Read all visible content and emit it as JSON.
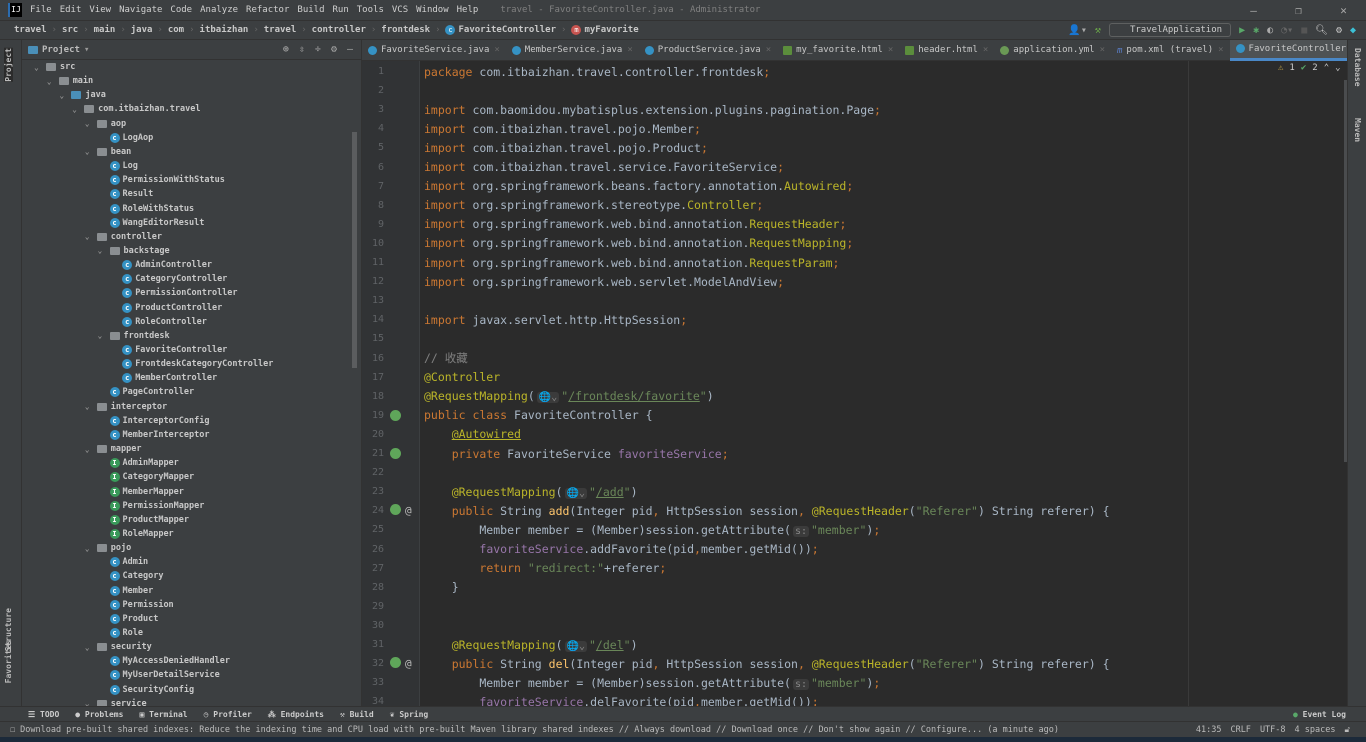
{
  "menu": {
    "items": [
      "File",
      "Edit",
      "View",
      "Navigate",
      "Code",
      "Analyze",
      "Refactor",
      "Build",
      "Run",
      "Tools",
      "VCS",
      "Window",
      "Help"
    ],
    "window_title": "travel - FavoriteController.java - Administrator"
  },
  "breadcrumb": [
    "travel",
    "src",
    "main",
    "java",
    "com",
    "itbaizhan",
    "travel",
    "controller",
    "frontdesk",
    "FavoriteController",
    "myFavorite"
  ],
  "toolbar": {
    "run_config": "TravelApplication"
  },
  "left_stripe": {
    "project": "Project",
    "structure": "Structure",
    "favorites": "Favorites"
  },
  "right_stripe": {
    "database": "Database",
    "maven": "Maven"
  },
  "project": {
    "title": "Project",
    "tree": [
      [
        "src",
        1,
        "folder"
      ],
      [
        "main",
        2,
        "folder"
      ],
      [
        "java",
        3,
        "folder-blue"
      ],
      [
        "com.itbaizhan.travel",
        4,
        "package"
      ],
      [
        "aop",
        5,
        "package"
      ],
      [
        "LogAop",
        6,
        "class"
      ],
      [
        "bean",
        5,
        "package"
      ],
      [
        "Log",
        6,
        "class"
      ],
      [
        "PermissionWithStatus",
        6,
        "class"
      ],
      [
        "Result",
        6,
        "class"
      ],
      [
        "RoleWithStatus",
        6,
        "class"
      ],
      [
        "WangEditorResult",
        6,
        "class"
      ],
      [
        "controller",
        5,
        "package"
      ],
      [
        "backstage",
        6,
        "package"
      ],
      [
        "AdminController",
        7,
        "class"
      ],
      [
        "CategoryController",
        7,
        "class"
      ],
      [
        "PermissionController",
        7,
        "class"
      ],
      [
        "ProductController",
        7,
        "class"
      ],
      [
        "RoleController",
        7,
        "class"
      ],
      [
        "frontdesk",
        6,
        "package"
      ],
      [
        "FavoriteController",
        7,
        "class"
      ],
      [
        "FrontdeskCategoryController",
        7,
        "class"
      ],
      [
        "MemberController",
        7,
        "class"
      ],
      [
        "PageController",
        6,
        "class"
      ],
      [
        "interceptor",
        5,
        "package"
      ],
      [
        "InterceptorConfig",
        6,
        "class"
      ],
      [
        "MemberInterceptor",
        6,
        "class"
      ],
      [
        "mapper",
        5,
        "package"
      ],
      [
        "AdminMapper",
        6,
        "mapper"
      ],
      [
        "CategoryMapper",
        6,
        "mapper"
      ],
      [
        "MemberMapper",
        6,
        "mapper"
      ],
      [
        "PermissionMapper",
        6,
        "mapper"
      ],
      [
        "ProductMapper",
        6,
        "mapper"
      ],
      [
        "RoleMapper",
        6,
        "mapper"
      ],
      [
        "pojo",
        5,
        "package"
      ],
      [
        "Admin",
        6,
        "class"
      ],
      [
        "Category",
        6,
        "class"
      ],
      [
        "Member",
        6,
        "class"
      ],
      [
        "Permission",
        6,
        "class"
      ],
      [
        "Product",
        6,
        "class"
      ],
      [
        "Role",
        6,
        "class"
      ],
      [
        "security",
        5,
        "package"
      ],
      [
        "MyAccessDeniedHandler",
        6,
        "class"
      ],
      [
        "MyUserDetailService",
        6,
        "class"
      ],
      [
        "SecurityConfig",
        6,
        "class"
      ],
      [
        "service",
        5,
        "package"
      ]
    ]
  },
  "tabs": [
    {
      "label": "FavoriteService.java",
      "icon": "class"
    },
    {
      "label": "MemberService.java",
      "icon": "class"
    },
    {
      "label": "ProductService.java",
      "icon": "class"
    },
    {
      "label": "my_favorite.html",
      "icon": "html"
    },
    {
      "label": "header.html",
      "icon": "html"
    },
    {
      "label": "application.yml",
      "icon": "yml"
    },
    {
      "label": "pom.xml (travel)",
      "icon": "m"
    },
    {
      "label": "FavoriteController.java",
      "icon": "class",
      "active": true
    }
  ],
  "inspections": {
    "warnings": "1",
    "weak_warnings": "2"
  },
  "code": [
    [
      [
        "k",
        "package "
      ],
      [
        "t",
        "com.itbaizhan.travel.controller.frontdesk"
      ],
      [
        "k",
        ";"
      ]
    ],
    [],
    [
      [
        "k",
        "import "
      ],
      [
        "t",
        "com.baomidou.mybatisplus.extension.plugins.pagination.Page"
      ],
      [
        "k",
        ";"
      ]
    ],
    [
      [
        "k",
        "import "
      ],
      [
        "t",
        "com.itbaizhan.travel.pojo.Member"
      ],
      [
        "k",
        ";"
      ]
    ],
    [
      [
        "k",
        "import "
      ],
      [
        "t",
        "com.itbaizhan.travel.pojo.Product"
      ],
      [
        "k",
        ";"
      ]
    ],
    [
      [
        "k",
        "import "
      ],
      [
        "t",
        "com.itbaizhan.travel.service.FavoriteService"
      ],
      [
        "k",
        ";"
      ]
    ],
    [
      [
        "k",
        "import "
      ],
      [
        "t",
        "org.springframework.beans.factory.annotation."
      ],
      [
        "a",
        "Autowired"
      ],
      [
        "k",
        ";"
      ]
    ],
    [
      [
        "k",
        "import "
      ],
      [
        "t",
        "org.springframework.stereotype."
      ],
      [
        "a",
        "Controller"
      ],
      [
        "k",
        ";"
      ]
    ],
    [
      [
        "k",
        "import "
      ],
      [
        "t",
        "org.springframework.web.bind.annotation."
      ],
      [
        "a",
        "RequestHeader"
      ],
      [
        "k",
        ";"
      ]
    ],
    [
      [
        "k",
        "import "
      ],
      [
        "t",
        "org.springframework.web.bind.annotation."
      ],
      [
        "a",
        "RequestMapping"
      ],
      [
        "k",
        ";"
      ]
    ],
    [
      [
        "k",
        "import "
      ],
      [
        "t",
        "org.springframework.web.bind.annotation."
      ],
      [
        "a",
        "RequestParam"
      ],
      [
        "k",
        ";"
      ]
    ],
    [
      [
        "k",
        "import "
      ],
      [
        "t",
        "org.springframework.web.servlet.ModelAndView"
      ],
      [
        "k",
        ";"
      ]
    ],
    [],
    [
      [
        "k",
        "import "
      ],
      [
        "t",
        "javax.servlet.http.HttpSession"
      ],
      [
        "k",
        ";"
      ]
    ],
    [],
    [
      [
        "c",
        "// 收藏"
      ]
    ],
    [
      [
        "a",
        "@Controller"
      ]
    ],
    [
      [
        "a",
        "@RequestMapping"
      ],
      [
        "t",
        "("
      ],
      [
        "h",
        "🌐⌄"
      ],
      [
        "s",
        "\""
      ],
      [
        "su",
        "/frontdesk/favorite"
      ],
      [
        "s",
        "\""
      ],
      [
        "t",
        ")"
      ]
    ],
    [
      [
        "k",
        "public class "
      ],
      [
        "t",
        "FavoriteController {"
      ]
    ],
    [
      [
        "t",
        "    "
      ],
      [
        "au",
        "@Autowired"
      ]
    ],
    [
      [
        "t",
        "    "
      ],
      [
        "k",
        "private "
      ],
      [
        "t",
        "FavoriteService "
      ],
      [
        "f",
        "favoriteService"
      ],
      [
        "k",
        ";"
      ]
    ],
    [],
    [
      [
        "t",
        "    "
      ],
      [
        "a",
        "@RequestMapping"
      ],
      [
        "t",
        "("
      ],
      [
        "h",
        "🌐⌄"
      ],
      [
        "s",
        "\""
      ],
      [
        "su",
        "/add"
      ],
      [
        "s",
        "\""
      ],
      [
        "t",
        ")"
      ]
    ],
    [
      [
        "t",
        "    "
      ],
      [
        "k",
        "public "
      ],
      [
        "t",
        "String "
      ],
      [
        "m",
        "add"
      ],
      [
        "t",
        "(Integer pid"
      ],
      [
        "k",
        ", "
      ],
      [
        "t",
        "HttpSession session"
      ],
      [
        "k",
        ", "
      ],
      [
        "a",
        "@RequestHeader"
      ],
      [
        "t",
        "("
      ],
      [
        "s",
        "\"Referer\""
      ],
      [
        "t",
        ") String referer) {"
      ]
    ],
    [
      [
        "t",
        "        Member member = (Member)session.getAttribute("
      ],
      [
        "h",
        "s:"
      ],
      [
        "s",
        "\"member\""
      ],
      [
        "t",
        ")"
      ],
      [
        "k",
        ";"
      ]
    ],
    [
      [
        "t",
        "        "
      ],
      [
        "f",
        "favoriteService"
      ],
      [
        "t",
        ".addFavorite(pid"
      ],
      [
        "k",
        ","
      ],
      [
        "t",
        "member.getMid())"
      ],
      [
        "k",
        ";"
      ]
    ],
    [
      [
        "t",
        "        "
      ],
      [
        "k",
        "return "
      ],
      [
        "s",
        "\"redirect:\""
      ],
      [
        "t",
        "+referer"
      ],
      [
        "k",
        ";"
      ]
    ],
    [
      [
        "t",
        "    }"
      ]
    ],
    [],
    [],
    [
      [
        "t",
        "    "
      ],
      [
        "a",
        "@RequestMapping"
      ],
      [
        "t",
        "("
      ],
      [
        "h",
        "🌐⌄"
      ],
      [
        "s",
        "\""
      ],
      [
        "su",
        "/del"
      ],
      [
        "s",
        "\""
      ],
      [
        "t",
        ")"
      ]
    ],
    [
      [
        "t",
        "    "
      ],
      [
        "k",
        "public "
      ],
      [
        "t",
        "String "
      ],
      [
        "m",
        "del"
      ],
      [
        "t",
        "(Integer pid"
      ],
      [
        "k",
        ", "
      ],
      [
        "t",
        "HttpSession session"
      ],
      [
        "k",
        ", "
      ],
      [
        "a",
        "@RequestHeader"
      ],
      [
        "t",
        "("
      ],
      [
        "s",
        "\"Referer\""
      ],
      [
        "t",
        ") String referer) {"
      ]
    ],
    [
      [
        "t",
        "        Member member = (Member)session.getAttribute("
      ],
      [
        "h",
        "s:"
      ],
      [
        "s",
        "\"member\""
      ],
      [
        "t",
        ")"
      ],
      [
        "k",
        ";"
      ]
    ],
    [
      [
        "t",
        "        "
      ],
      [
        "f",
        "favoriteService"
      ],
      [
        "t",
        ".delFavorite(pid"
      ],
      [
        "k",
        ","
      ],
      [
        "t",
        "member.getMid())"
      ],
      [
        "k",
        ";"
      ]
    ]
  ],
  "gutter_beans": [
    19,
    21,
    24,
    32
  ],
  "gutter_at": [
    24,
    32
  ],
  "bottom_tools": [
    "TODO",
    "Problems",
    "Terminal",
    "Profiler",
    "Endpoints",
    "Build",
    "Spring"
  ],
  "event_log": "Event Log",
  "status": {
    "message": "Download pre-built shared indexes: Reduce the indexing time and CPU load with pre-built Maven library shared indexes // Always download // Download once // Don't show again // Configure... (a minute ago)",
    "position": "41:35",
    "line_sep": "CRLF",
    "encoding": "UTF-8",
    "indent": "4 spaces"
  },
  "colors": {
    "keyword": "#cc7832",
    "annotation": "#bbb529",
    "string": "#6a8759",
    "comment": "#808080",
    "field": "#9876aa",
    "method": "#ffc66d",
    "accent": "#4a88c7"
  }
}
